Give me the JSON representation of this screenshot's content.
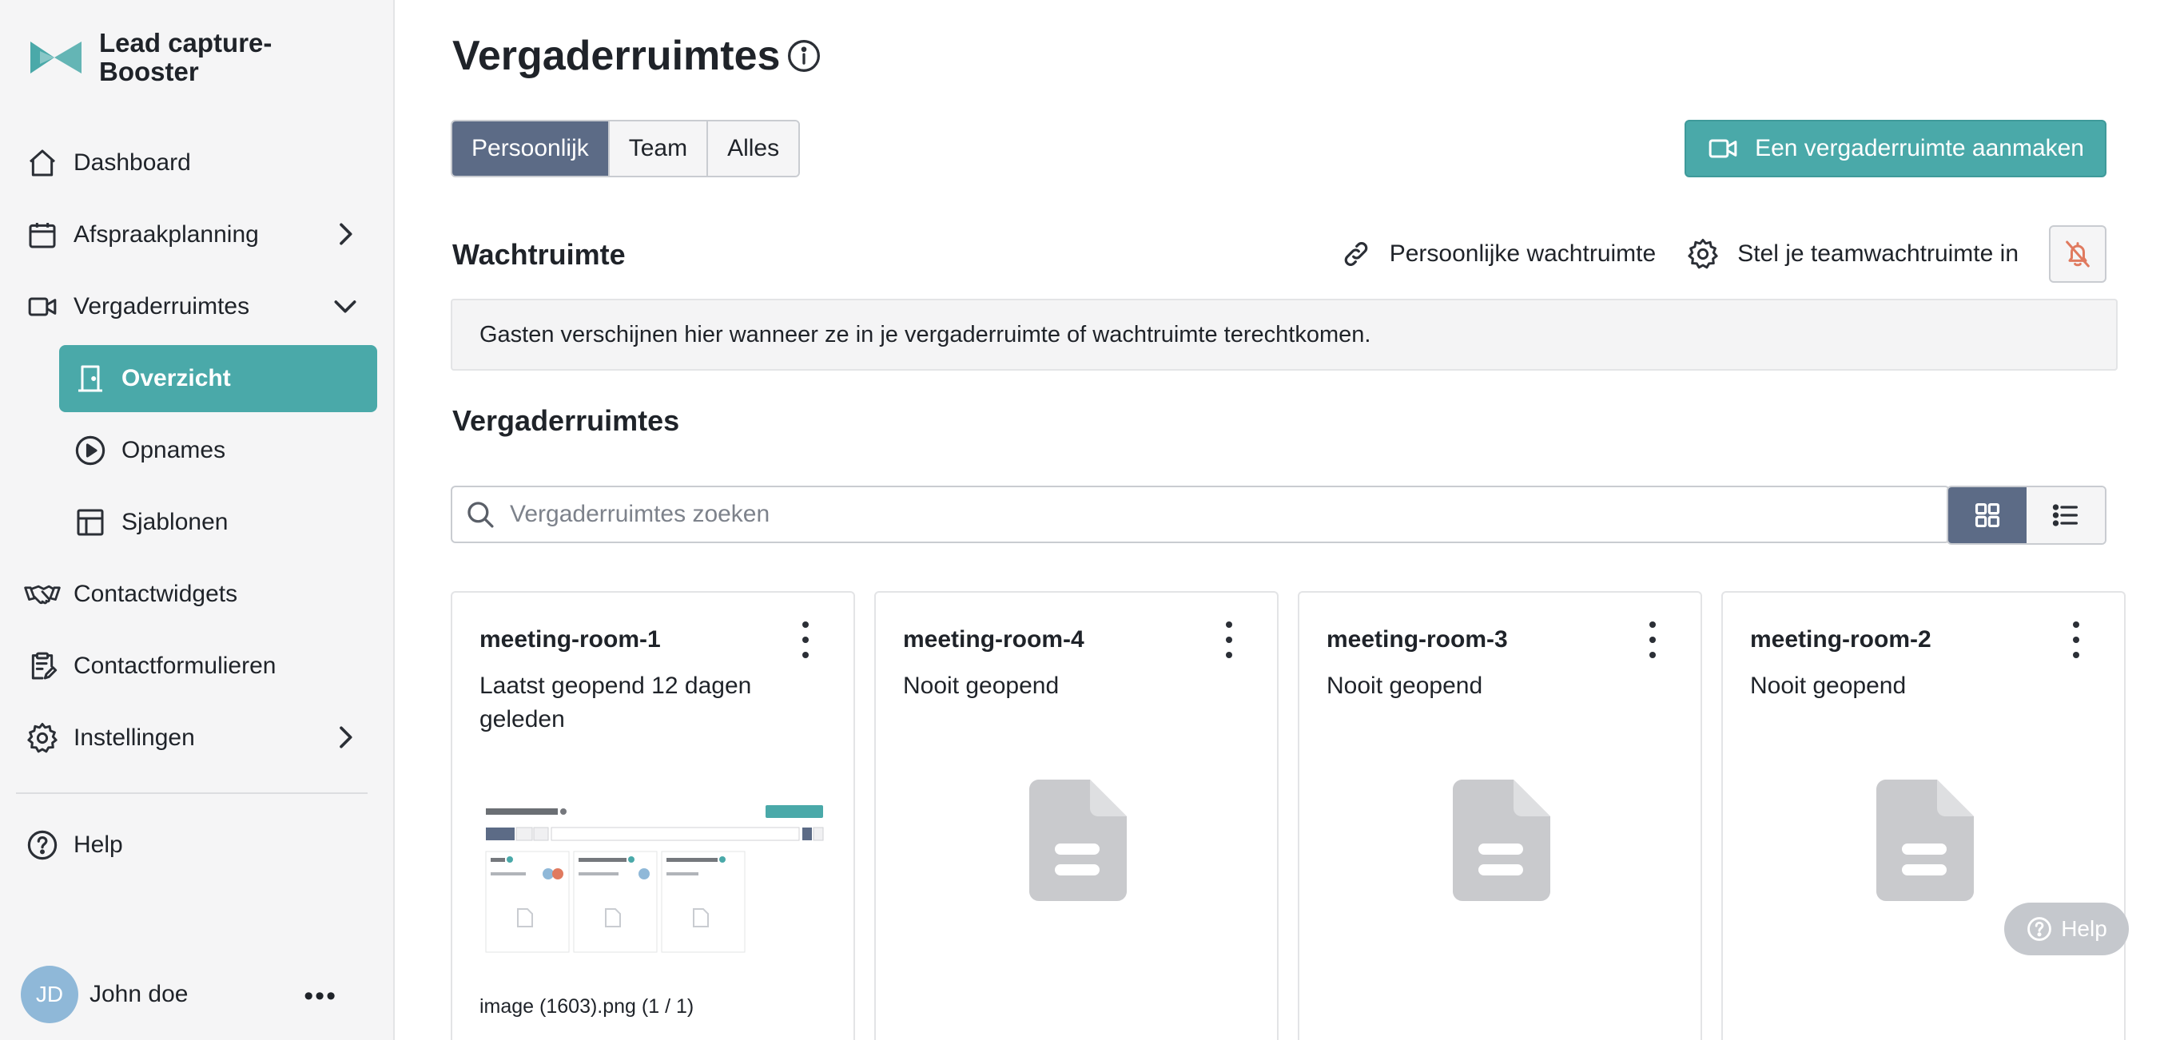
{
  "brand": {
    "name": "Lead capture-Booster",
    "color": "#4aa9a9"
  },
  "sidebar": {
    "items": [
      {
        "label": "Dashboard",
        "icon": "home-icon"
      },
      {
        "label": "Afspraakplanning",
        "icon": "calendar-icon",
        "chevron": "chevron-right-icon"
      },
      {
        "label": "Vergaderruimtes",
        "icon": "video-camera-icon",
        "chevron": "chevron-down-icon"
      },
      {
        "label": "Overzicht",
        "icon": "door-icon",
        "active": true
      },
      {
        "label": "Opnames",
        "icon": "play-circle-icon"
      },
      {
        "label": "Sjablonen",
        "icon": "template-icon"
      },
      {
        "label": "Contactwidgets",
        "icon": "handshake-icon"
      },
      {
        "label": "Contactformulieren",
        "icon": "clipboard-icon"
      },
      {
        "label": "Instellingen",
        "icon": "gear-icon",
        "chevron": "chevron-right-icon"
      },
      {
        "label": "Help",
        "icon": "help-circle-icon"
      }
    ],
    "user": {
      "initials": "JD",
      "name": "John doe",
      "more": "•••"
    }
  },
  "main": {
    "title": "Vergaderruimtes",
    "tabs": [
      {
        "label": "Persoonlijk",
        "active": true
      },
      {
        "label": "Team",
        "active": false
      },
      {
        "label": "Alles",
        "active": false
      }
    ],
    "create_button": "Een vergaderruimte aanmaken",
    "waiting": {
      "title": "Wachtruimte",
      "personal_link": "Persoonlijke wachtruimte",
      "team_link": "Stel je teamwachtruimte in",
      "notice": "Gasten verschijnen hier wanneer ze in je vergaderruimte of wachtruimte terechtkomen."
    },
    "rooms_title": "Vergaderruimtes",
    "search": {
      "placeholder": "Vergaderruimtes zoeken",
      "value": ""
    },
    "cards": [
      {
        "name": "meeting-room-1",
        "status": "Laatst geopend 12 dagen geleden",
        "caption": "image (1603).png (1 / 1)"
      },
      {
        "name": "meeting-room-4",
        "status": "Nooit geopend"
      },
      {
        "name": "meeting-room-3",
        "status": "Nooit geopend"
      },
      {
        "name": "meeting-room-2",
        "status": "Nooit geopend"
      }
    ],
    "help_bubble": "Help"
  },
  "colors": {
    "accent": "#4aa9a9",
    "tab_active": "#5c6b86",
    "bell_muted": "#e07a5f"
  }
}
